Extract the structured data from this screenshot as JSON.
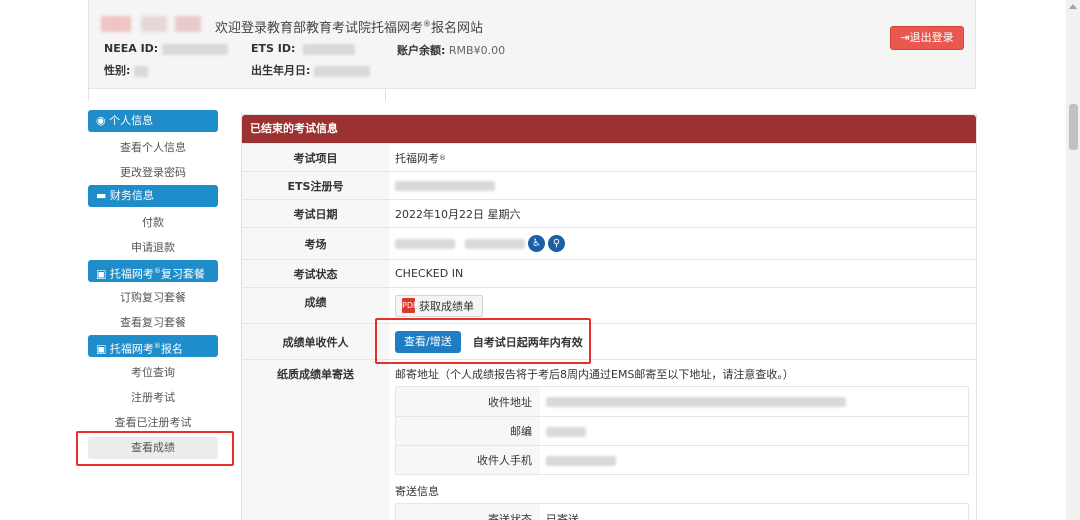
{
  "header": {
    "welcome_text": "欢迎登录教育部教育考试院托福网考",
    "welcome_reg": "®",
    "welcome_suffix": "报名网站",
    "neea_id_label": "NEEA ID:",
    "ets_id_label": "ETS ID:",
    "balance_label": "账户余额:",
    "balance_value": "RMB¥0.00",
    "gender_label": "性别:",
    "dob_label": "出生年月日:",
    "logout_label": "退出登录",
    "logout_icon": "sign-out-icon"
  },
  "sidebar": {
    "sections": [
      {
        "title": "个人信息",
        "icon": "user-circle-icon",
        "items": [
          "查看个人信息",
          "更改登录密码"
        ]
      },
      {
        "title": "财务信息",
        "icon": "credit-card-icon",
        "items": [
          "付款",
          "申请退款"
        ]
      },
      {
        "title_pre": "托福网考",
        "title_reg": "®",
        "title_post": "复习套餐",
        "icon": "book-icon",
        "items": [
          "订购复习套餐",
          "查看复习套餐"
        ]
      },
      {
        "title_pre": "托福网考",
        "title_reg": "®",
        "title_post": "报名",
        "icon": "book-icon",
        "items": [
          "考位查询",
          "注册考试",
          "查看已注册考试",
          "查看成绩"
        ]
      }
    ],
    "active_item": "查看成绩"
  },
  "main": {
    "panel_title": "已结束的考试信息",
    "rows": {
      "exam_item_label": "考试项目",
      "exam_item_value": "托福网考",
      "exam_item_reg": "®",
      "ets_reg_label": "ETS注册号",
      "exam_date_label": "考试日期",
      "exam_date_value": "2022年10月22日 星期六",
      "venue_label": "考场",
      "venue_icon1": "wheelchair-icon",
      "venue_icon2": "restroom-icon",
      "status_label": "考试状态",
      "status_value": "CHECKED IN",
      "score_label": "成绩",
      "score_button": "获取成绩单",
      "score_icon": "pdf-icon",
      "recipient_label": "成绩单收件人",
      "recipient_button": "查看/增送",
      "recipient_note": "自考试日起两年内有效",
      "paper_label": "纸质成绩单寄送",
      "mail_address_note": "邮寄地址（个人成绩报告将于考后8周内通过EMS邮寄至以下地址，请注意查收。）",
      "addr_label": "收件地址",
      "zip_label": "邮编",
      "phone_label": "收件人手机",
      "send_info_title": "寄送信息",
      "send_status_label": "寄送状态",
      "send_status_value": "已寄送"
    }
  },
  "colors": {
    "sidebar_header": "#1f8dc9",
    "panel_header": "#9b3130",
    "logout_button": "#e9574f",
    "primary_button": "#1f7dc4",
    "highlight_box": "#e4312b"
  }
}
